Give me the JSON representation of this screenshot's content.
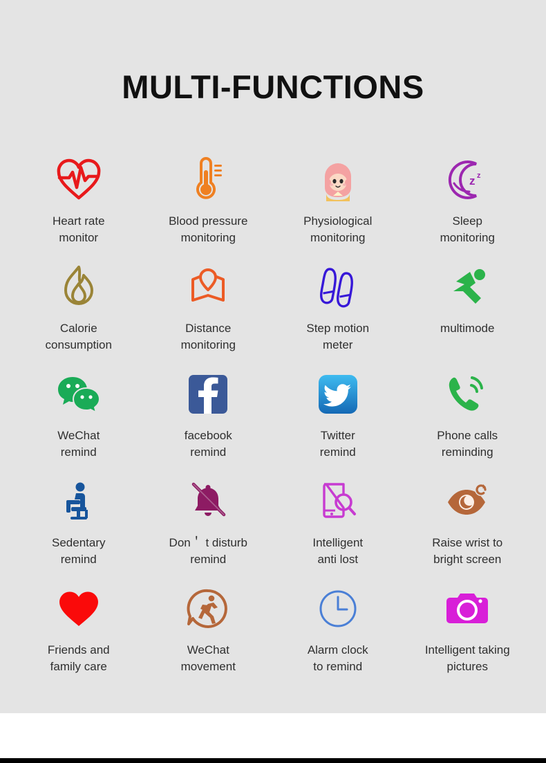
{
  "page": {
    "title": "MULTI-FUNCTIONS",
    "background_color": "#e4e4e4",
    "text_color": "#2f2f2f",
    "title_color": "#111111"
  },
  "features": [
    {
      "icon": "heart-rate-icon",
      "label": "Heart rate\nmonitor",
      "color": "#e8191b"
    },
    {
      "icon": "thermometer-icon",
      "label": "Blood pressure\nmonitoring",
      "color": "#ef8022"
    },
    {
      "icon": "girl-avatar-icon",
      "label": "Physiological\nmonitoring",
      "color": "#f4a2a2"
    },
    {
      "icon": "moon-sleep-icon",
      "label": "Sleep\nmonitoring",
      "color": "#9c27b0"
    },
    {
      "icon": "flame-icon",
      "label": "Calorie\nconsumption",
      "color": "#9a8437"
    },
    {
      "icon": "map-pin-icon",
      "label": "Distance\nmonitoring",
      "color": "#ec5b25"
    },
    {
      "icon": "footsteps-icon",
      "label": "Step motion\nmeter",
      "color": "#3718d8"
    },
    {
      "icon": "runner-multimode-icon",
      "label": "multimode",
      "color": "#2bb34a"
    },
    {
      "icon": "wechat-icon",
      "label": "WeChat\nremind",
      "color": "#1aab57"
    },
    {
      "icon": "facebook-icon",
      "label": "facebook\nremind",
      "color": "#3b5998"
    },
    {
      "icon": "twitter-icon",
      "label": "Twitter\nremind",
      "color": "#1d9bdd"
    },
    {
      "icon": "phone-call-icon",
      "label": "Phone calls\nreminding",
      "color": "#2bb34a"
    },
    {
      "icon": "sedentary-person-icon",
      "label": "Sedentary\nremind",
      "color": "#17559c"
    },
    {
      "icon": "bell-muted-icon",
      "label": "Don＇ t disturb\nremind",
      "color": "#8d1b63"
    },
    {
      "icon": "phone-search-icon",
      "label": "Intelligent\nanti lost",
      "color": "#c73bd1"
    },
    {
      "icon": "eye-refresh-icon",
      "label": "Raise wrist to\nbright screen",
      "color": "#b5673a"
    },
    {
      "icon": "heart-solid-icon",
      "label": "Friends and\nfamily care",
      "color": "#fa0a0a"
    },
    {
      "icon": "wechat-movement-icon",
      "label": "WeChat\nmovement",
      "color": "#b5673a"
    },
    {
      "icon": "alarm-clock-icon",
      "label": "Alarm clock\nto remind",
      "color": "#4a7fd6"
    },
    {
      "icon": "camera-icon",
      "label": "Intelligent taking\npictures",
      "color": "#d81fd8"
    }
  ]
}
